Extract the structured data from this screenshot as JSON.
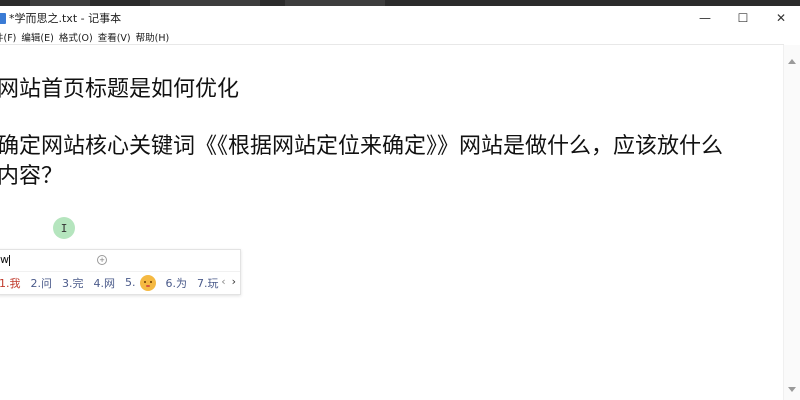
{
  "window": {
    "title": "*学而思之.txt - 记事本",
    "controls": {
      "minimize": "—",
      "maximize": "☐",
      "close": "✕"
    }
  },
  "menu": {
    "items": [
      "件(F)",
      "编辑(E)",
      "格式(O)",
      "查看(V)",
      "帮助(H)"
    ]
  },
  "editor": {
    "lines": [
      "网站首页标题是如何优化",
      "确定网站核心关键词《《根据网站定位来确定》》网站是做什么，应该放什么",
      "内容？"
    ]
  },
  "ime": {
    "input": "w",
    "candidates": [
      {
        "index": "1.",
        "text": "我"
      },
      {
        "index": "2.",
        "text": "问"
      },
      {
        "index": "3.",
        "text": "完"
      },
      {
        "index": "4.",
        "text": "网"
      },
      {
        "index": "5.",
        "text": ""
      },
      {
        "index": "6.",
        "text": "为"
      },
      {
        "index": "7.",
        "text": "玩"
      }
    ],
    "prev": "‹",
    "next": "›",
    "emoji_icon": "kissing-face-emoji"
  },
  "colors": {
    "accent_first_candidate": "#c0392b",
    "candidate_text": "#4a5a8a",
    "cursor_marker": "#b5e5be"
  }
}
